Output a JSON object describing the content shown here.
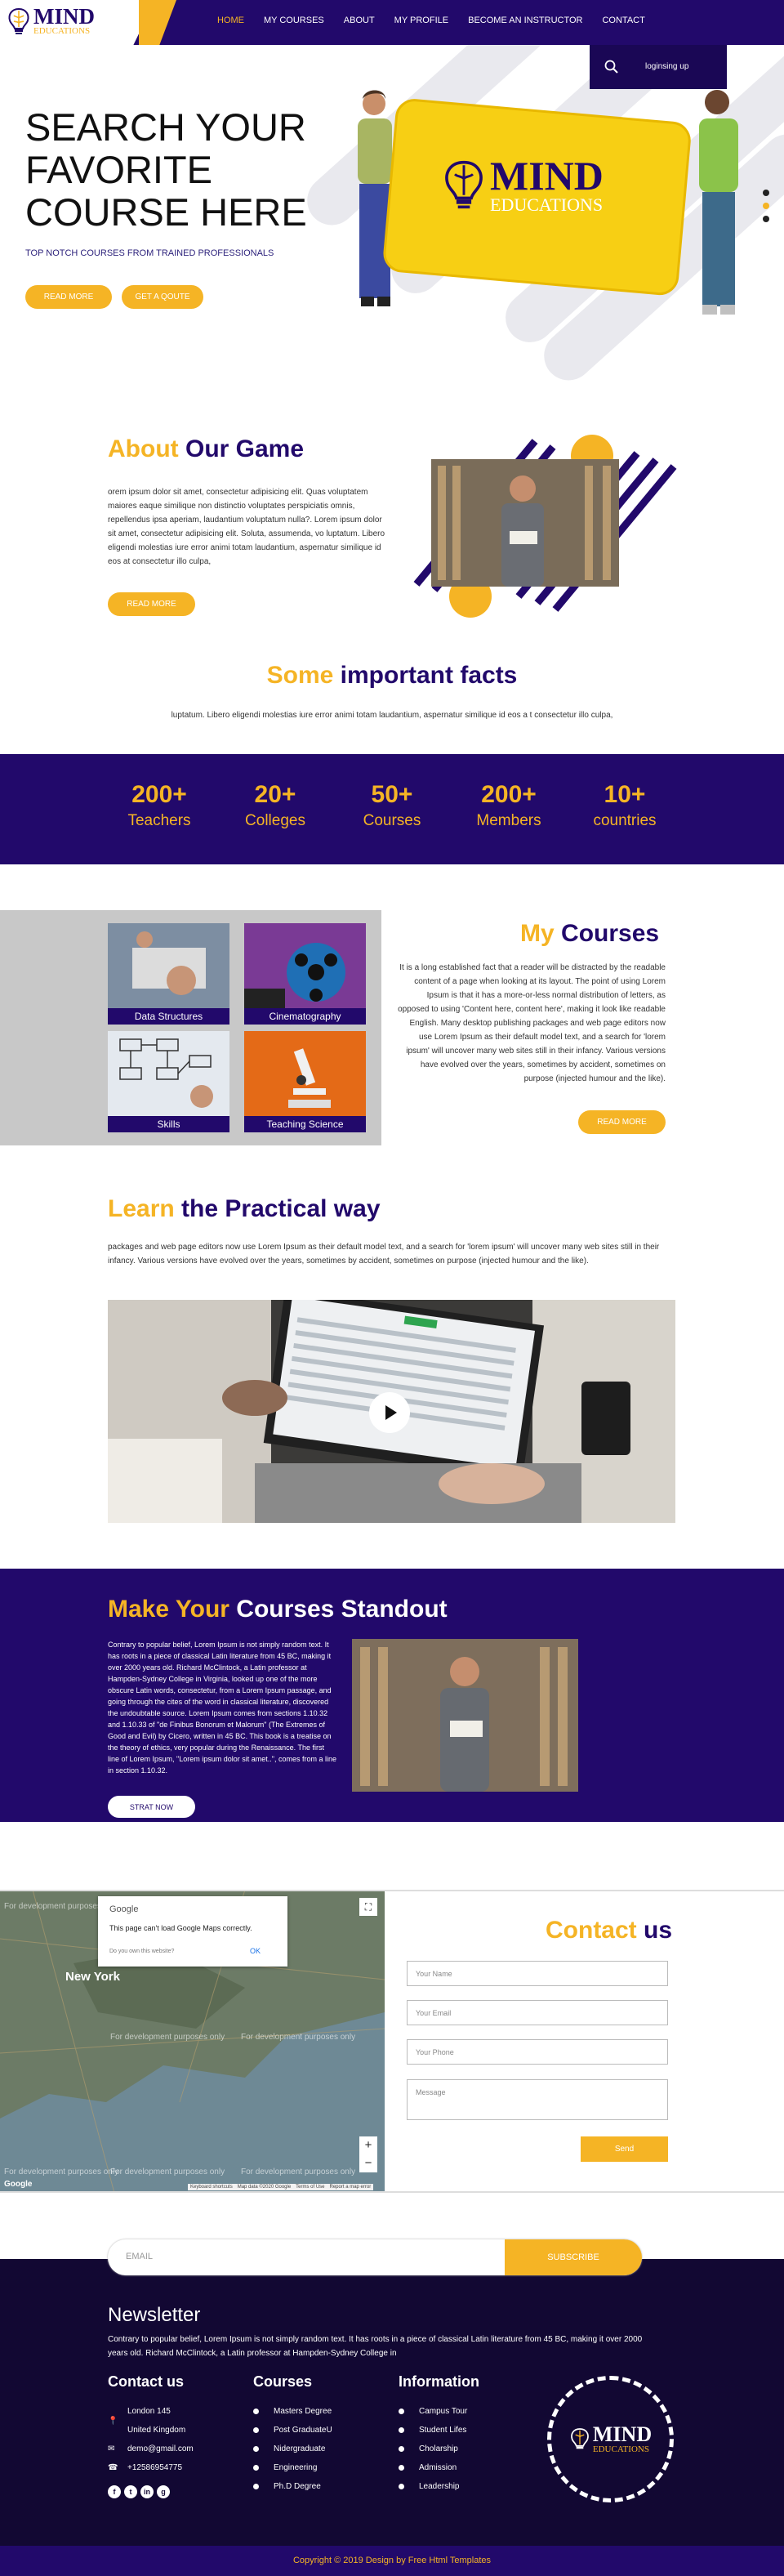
{
  "brand": {
    "name": "MIND",
    "sub": "EDUCATIONS"
  },
  "nav": {
    "home": "HOME",
    "courses": "MY COURSES",
    "about": "ABOUT",
    "profile": "MY PROFILE",
    "instructor": "BECOME AN INSTRUCTOR",
    "contact": "CONTACT"
  },
  "dropdown": {
    "label": "loginsing up"
  },
  "hero": {
    "line1": "SEARCH YOUR",
    "line2": "FAVORITE",
    "line3": "COURSE HERE",
    "subtitle": "TOP NOTCH COURSES FROM TRAINED PROFESSIONALS",
    "read_more": "READ MORE",
    "quote": "GET A QOUTE",
    "sign_name": "MIND",
    "sign_sub": "EDUCATIONS"
  },
  "about": {
    "title_a": "About",
    "title_b": "Our Game",
    "text": "orem ipsum dolor sit amet, consectetur adipisicing elit. Quas voluptatem maiores eaque similique non distinctio voluptates perspiciatis omnis, repellendus ipsa aperiam, laudantium voluptatum nulla?. Lorem ipsum dolor sit amet, consectetur adipisicing elit. Soluta, assumenda, vo luptatum. Libero eligendi molestias iure error animi totam laudantium, aspernatur similique id eos at consectetur illo culpa,",
    "button": "READ MORE"
  },
  "facts": {
    "title_a": "Some",
    "title_b": "important facts",
    "text": "luptatum. Libero eligendi molestias iure error animi totam laudantium, aspernatur similique id eos a t consectetur illo culpa,",
    "items": [
      {
        "n": "200+",
        "l": "Teachers"
      },
      {
        "n": "20+",
        "l": "Colleges"
      },
      {
        "n": "50+",
        "l": "Courses"
      },
      {
        "n": "200+",
        "l": "Members"
      },
      {
        "n": "10+",
        "l": "countries"
      }
    ]
  },
  "courses": {
    "title_a": "My",
    "title_b": "Courses",
    "cards": [
      "Data Structures",
      "Cinematography",
      "Skills",
      "Teaching Science"
    ],
    "text": "It is a long established fact that a reader will be distracted by the readable content of a page when looking at its layout. The point of using Lorem Ipsum is that it has a more-or-less normal distribution of letters, as opposed to using 'Content here, content here', making it look like readable English. Many desktop publishing packages and web page editors now use Lorem Ipsum as their default model text, and a search for 'lorem ipsum' will uncover many web sites still in their infancy. Various versions have evolved over the years, sometimes by accident, sometimes on purpose (injected humour and the like).",
    "button": "READ MORE"
  },
  "learn": {
    "title_a": "Learn",
    "title_b": "the Practical way",
    "text": "packages and web page editors now use Lorem Ipsum as their default model text, and a search for 'lorem ipsum' will uncover many web sites still in their infancy. Various versions have evolved over the years, sometimes by accident, sometimes on purpose (injected humour and the like)."
  },
  "standout": {
    "title_a": "Make Your",
    "title_b": "Courses Standout",
    "text": "Contrary to popular belief, Lorem Ipsum is not simply random text. It has roots in a piece of classical Latin literature from 45 BC, making it over 2000 years old. Richard McClintock, a Latin professor at Hampden-Sydney College in Virginia, looked up one of the more obscure Latin words, consectetur, from a Lorem Ipsum passage, and going through the cites of the word in classical literature, discovered the undoubtable source. Lorem Ipsum comes from sections 1.10.32 and 1.10.33 of \"de Finibus Bonorum et Malorum\" (The Extremes of Good and Evil) by Cicero, written in 45 BC. This book is a treatise on the theory of ethics, very popular during the Renaissance. The first line of Lorem Ipsum, \"Lorem ipsum dolor sit amet..\", comes from a line in section 1.10.32.",
    "button": "STRAT NOW"
  },
  "map": {
    "google": "Google",
    "error": "This page can't load Google Maps correctly.",
    "own": "Do you own this website?",
    "ok": "OK",
    "dev": "For development purposes only",
    "city": "New York",
    "logo": "Google",
    "attrib1": "Keyboard shortcuts",
    "attrib2": "Map data ©2020 Google",
    "attrib3": "Terms of Use",
    "attrib4": "Report a map error"
  },
  "contact": {
    "title_a": "Contact",
    "title_b": "us",
    "name_ph": "Your Name",
    "email_ph": "Your Email",
    "phone_ph": "Your Phone",
    "msg_ph": "Message",
    "send": "Send"
  },
  "subscribe": {
    "placeholder": "EMAIL",
    "button": "SUBSCRIBE"
  },
  "footer": {
    "news_title": "Newsletter",
    "news_text": "Contrary to popular belief, Lorem Ipsum is not simply random text. It has roots in a piece of classical Latin literature from 45 BC, making it over 2000 years old. Richard McClintock, a Latin professor at Hampden-Sydney College in",
    "contact_title": "Contact us",
    "addr1": "London 145",
    "addr2": "United Kingdom",
    "email": "demo@gmail.com",
    "phone": "+12586954775",
    "courses_title": "Courses",
    "courses": [
      "Masters Degree",
      "Post GraduateU",
      "Nidergraduate",
      "Engineering",
      "Ph.D Degree"
    ],
    "info_title": "Information",
    "info": [
      "Campus Tour",
      "Student Lifes",
      "Cholarship",
      "Admission",
      "Leadership"
    ],
    "social": [
      "f",
      "t",
      "in",
      "g"
    ],
    "logo_name": "MIND",
    "logo_sub": "EDUCATIONS"
  },
  "copyright": "Copyright © 2019 Design by Free Html Templates",
  "colors": {
    "primary": "#22096b",
    "accent": "#f5b425",
    "footer": "#120833"
  }
}
